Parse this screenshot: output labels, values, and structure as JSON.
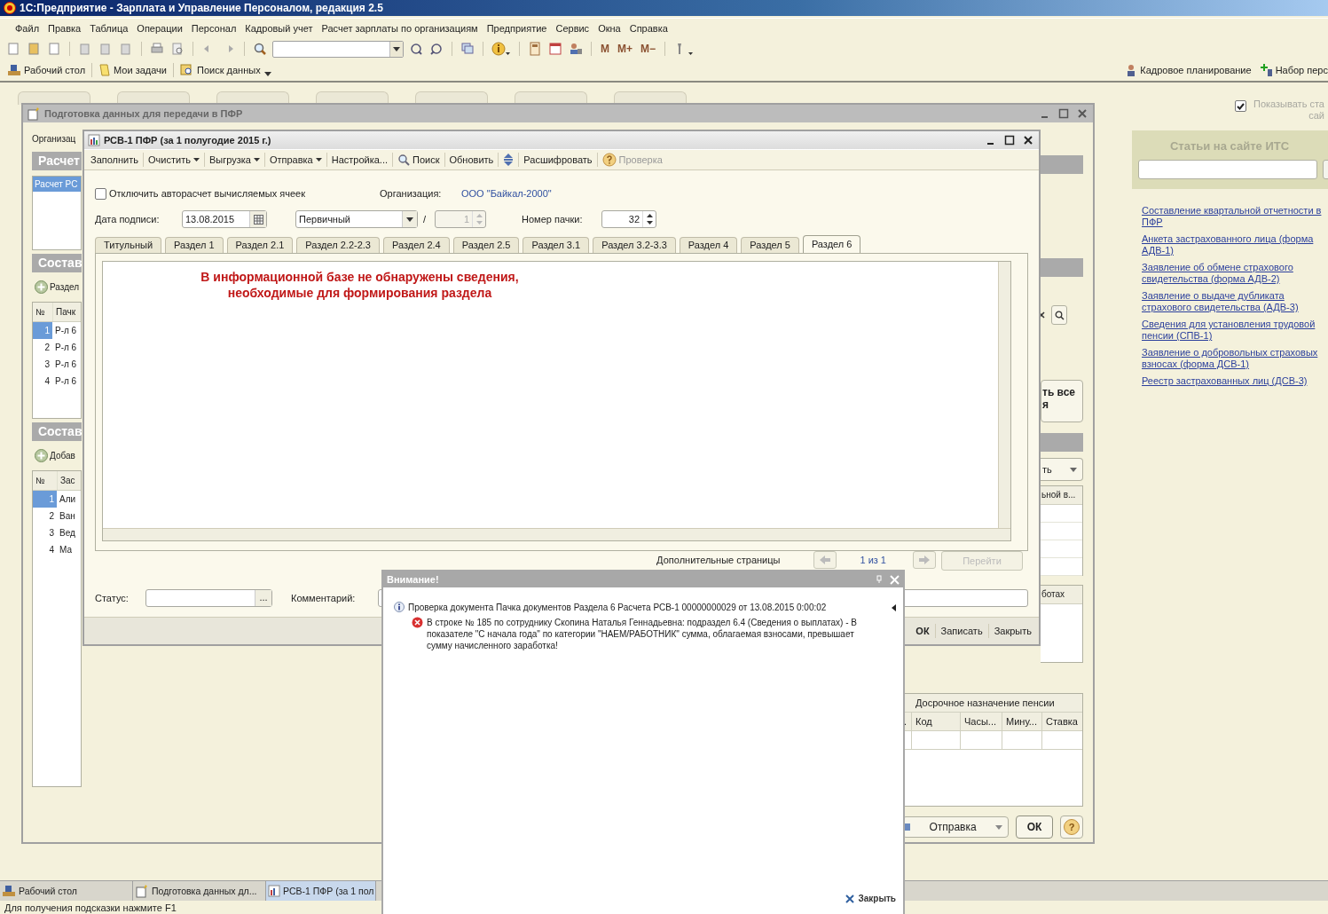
{
  "app_title": "1С:Предприятие - Зарплата и Управление Персоналом, редакция 2.5",
  "menu": [
    "Файл",
    "Правка",
    "Таблица",
    "Операции",
    "Персонал",
    "Кадровый учет",
    "Расчет зарплаты по организациям",
    "Предприятие",
    "Сервис",
    "Окна",
    "Справка"
  ],
  "toolbar": {
    "memory": [
      "M",
      "M+",
      "M−"
    ]
  },
  "panel": {
    "left": [
      "Рабочий стол",
      "Мои задачи",
      "Поиск данных"
    ],
    "right": [
      "Кадровое планирование",
      "Набор перс"
    ]
  },
  "its_toggle": {
    "lines": [
      "Показывать ста",
      "сай"
    ],
    "checked": true
  },
  "its_panel": {
    "title": "Статьи на сайте ИТС",
    "links": [
      "Составление квартальной отчетности в ПФР",
      "Анкета застрахованного лица (форма АДВ-1)",
      "Заявление об обмене страхового свидетельства (форма АДВ-2)",
      "Заявление о выдаче дубликата страхового свидетельства (АДВ-3)",
      "Сведения для установления трудовой пенсии (СПВ-1)",
      "Заявление о добровольных страховых взносах (форма ДСВ-1)",
      "Реестр застрахованных лиц (ДСВ-3)"
    ]
  },
  "prep_window": {
    "title": "Подготовка данных для передачи в ПФР",
    "org_label": "Организац",
    "section_1": "Расчет",
    "list": [
      {
        "text": "Расчет РС",
        "selected": true
      }
    ],
    "section_2": "Состав",
    "add_1": "Раздел",
    "table_1": {
      "columns": [
        "№",
        "Пачк"
      ],
      "rows": [
        {
          "n": "1",
          "value": "Р-л 6",
          "selected": true
        },
        {
          "n": "2",
          "value": "Р-л 6",
          "selected": false
        },
        {
          "n": "3",
          "value": "Р-л 6",
          "selected": false
        },
        {
          "n": "4",
          "value": "Р-л 6",
          "selected": false
        }
      ]
    },
    "section_3": "Состав",
    "add_2": "Добав",
    "table_2": {
      "columns": [
        "№",
        "Зас"
      ],
      "rows": [
        {
          "n": "1",
          "value": "Али",
          "selected": true
        },
        {
          "n": "2",
          "value": "Ван",
          "selected": false
        },
        {
          "n": "3",
          "value": "Вед",
          "selected": false
        },
        {
          "n": "4",
          "value": "Ма",
          "selected": false
        }
      ]
    },
    "right_button": [
      "ть все",
      "я"
    ],
    "right_dropdown": "ть",
    "right_table_header": "ьной в...",
    "right_box_header": "ботах",
    "pension_table": {
      "title": "Досрочное назначение пенсии",
      "columns": [
        ".",
        "Код",
        "Часы...",
        "Мину...",
        "Ставка"
      ]
    },
    "send_button": "Отправка",
    "ok_button": "ОК",
    "help_button": "?"
  },
  "rsv_window": {
    "title": "РСВ-1 ПФР (за 1 полугодие 2015 г.)",
    "toolbar": [
      {
        "kind": "text",
        "label": "Заполнить",
        "disabled": false
      },
      {
        "kind": "menu",
        "label": "Очистить",
        "disabled": false
      },
      {
        "kind": "menu",
        "label": "Выгрузка",
        "disabled": false
      },
      {
        "kind": "menu",
        "label": "Отправка",
        "disabled": false
      },
      {
        "kind": "text",
        "label": "Настройка...",
        "disabled": false
      },
      {
        "kind": "search",
        "label": "Поиск",
        "disabled": false
      },
      {
        "kind": "text",
        "label": "Обновить",
        "disabled": false
      },
      {
        "kind": "arrows",
        "disabled": false
      },
      {
        "kind": "text",
        "label": "Расшифровать",
        "disabled": false
      },
      {
        "kind": "help",
        "label": "Проверка",
        "disabled": true
      }
    ],
    "autocalc": {
      "label": "Отключить авторасчет вычисляемых ячеек",
      "checked": false
    },
    "org_label": "Организация:",
    "org_value": "ООО \"Байкал-2000\"",
    "date_label": "Дата подписи:",
    "date": "13.08.2015",
    "type": "Первичный",
    "slash": "/",
    "corr_number": {
      "value": "1",
      "disabled": true
    },
    "pack_label": "Номер пачки:",
    "pack_number": "32",
    "tabs": [
      {
        "label": "Титульный",
        "selected": false
      },
      {
        "label": "Раздел 1",
        "selected": false
      },
      {
        "label": "Раздел 2.1",
        "selected": false
      },
      {
        "label": "Раздел 2.2-2.3",
        "selected": false
      },
      {
        "label": "Раздел 2.4",
        "selected": false
      },
      {
        "label": "Раздел 2.5",
        "selected": false
      },
      {
        "label": "Раздел 3.1",
        "selected": false
      },
      {
        "label": "Раздел 3.2-3.3",
        "selected": false
      },
      {
        "label": "Раздел 4",
        "selected": false
      },
      {
        "label": "Раздел 5",
        "selected": false
      },
      {
        "label": "Раздел 6",
        "selected": true
      }
    ],
    "message": "В информационной базе не обнаружены сведения,\nнеобходимые для формирования раздела",
    "extra_pages_label": "Дополнительные страницы",
    "page_counter": "1 из 1",
    "go_button": {
      "label": "Перейти",
      "disabled": true
    },
    "status_label": "Статус:",
    "status_button": "...",
    "comment_label": "Комментарий:",
    "buttons": [
      "ОК",
      "Записать",
      "Закрыть"
    ]
  },
  "alert": {
    "title": "Внимание!",
    "messages": [
      {
        "kind": "info",
        "text": "Проверка документа Пачка документов Раздела 6 Расчета РСВ-1 00000000029 от 13.08.2015 0:00:02"
      },
      {
        "kind": "error",
        "text": "В строке № 185 по сотруднику Скопина Наталья Геннадьевна: подраздел 6.4 (Сведения о выплатах) - В показателе \"С начала года\" по категории \"НАЕМ/РАБОТНИК\" сумма, облагаемая взносами, превышает сумму начисленного заработка!"
      }
    ],
    "close": "Закрыть"
  },
  "taskbar": [
    {
      "label": "Рабочий стол",
      "selected": false
    },
    {
      "label": "Подготовка данных дл...",
      "selected": false
    },
    {
      "label": "РСВ-1 ПФР (за 1 пол",
      "selected": true
    }
  ],
  "status_bar": "Для получения подсказки нажмите F1"
}
